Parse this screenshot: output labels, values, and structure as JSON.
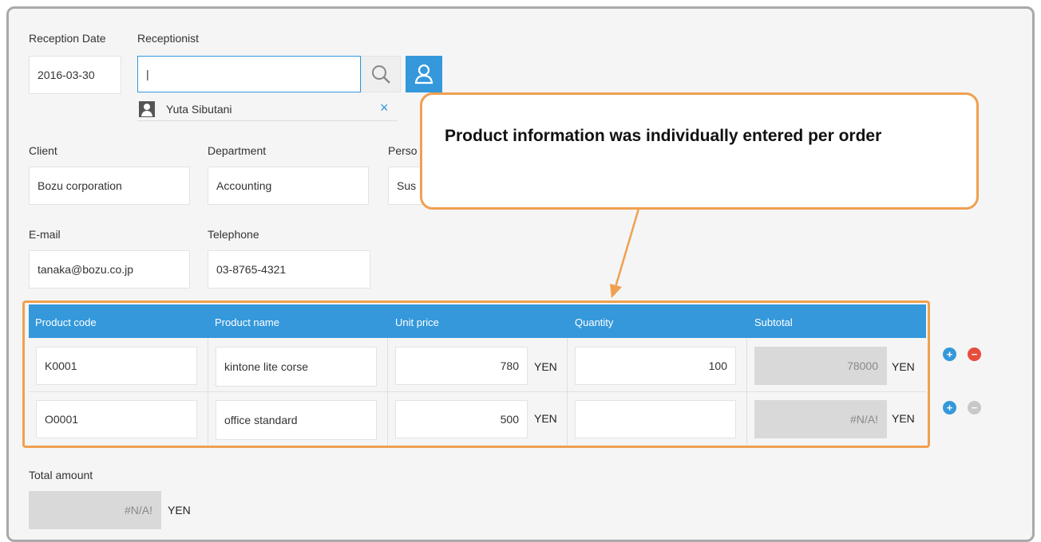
{
  "colors": {
    "accent": "#3498db",
    "callout_border": "#f0a050",
    "table_highlight": "#f0a050",
    "remove_active": "#e74c3c",
    "remove_disabled": "#c8c8c8"
  },
  "reception": {
    "date_label": "Reception Date",
    "date_value": "2016-03-30",
    "receptionist_label": "Receptionist",
    "receptionist_value": "|",
    "selected_user": "Yuta Sibutani",
    "search_icon": "search-icon",
    "user_icon": "user-icon"
  },
  "client": {
    "label": "Client",
    "value": "Bozu corporation"
  },
  "department": {
    "label": "Department",
    "value": "Accounting"
  },
  "person": {
    "label": "Perso",
    "value": "Sus"
  },
  "email": {
    "label": "E-mail",
    "value": "tanaka@bozu.co.jp"
  },
  "telephone": {
    "label": "Telephone",
    "value": "03-8765-4321"
  },
  "table": {
    "headers": [
      "Product code",
      "Product name",
      "Unit price",
      "Quantity",
      "Subtotal"
    ],
    "currency": "YEN",
    "rows": [
      {
        "code": "K0001",
        "name": "kintone lite corse",
        "unit_price": "780",
        "quantity": "100",
        "subtotal": "78000",
        "add": "+",
        "remove": "−"
      },
      {
        "code": "O0001",
        "name": "office standard",
        "unit_price": "500",
        "quantity": "",
        "subtotal": "#N/A!",
        "add": "+",
        "remove": "−"
      }
    ]
  },
  "total": {
    "label": "Total amount",
    "value": "#N/A!",
    "currency": "YEN"
  },
  "callout": {
    "text": "Product information was individually entered per order"
  }
}
